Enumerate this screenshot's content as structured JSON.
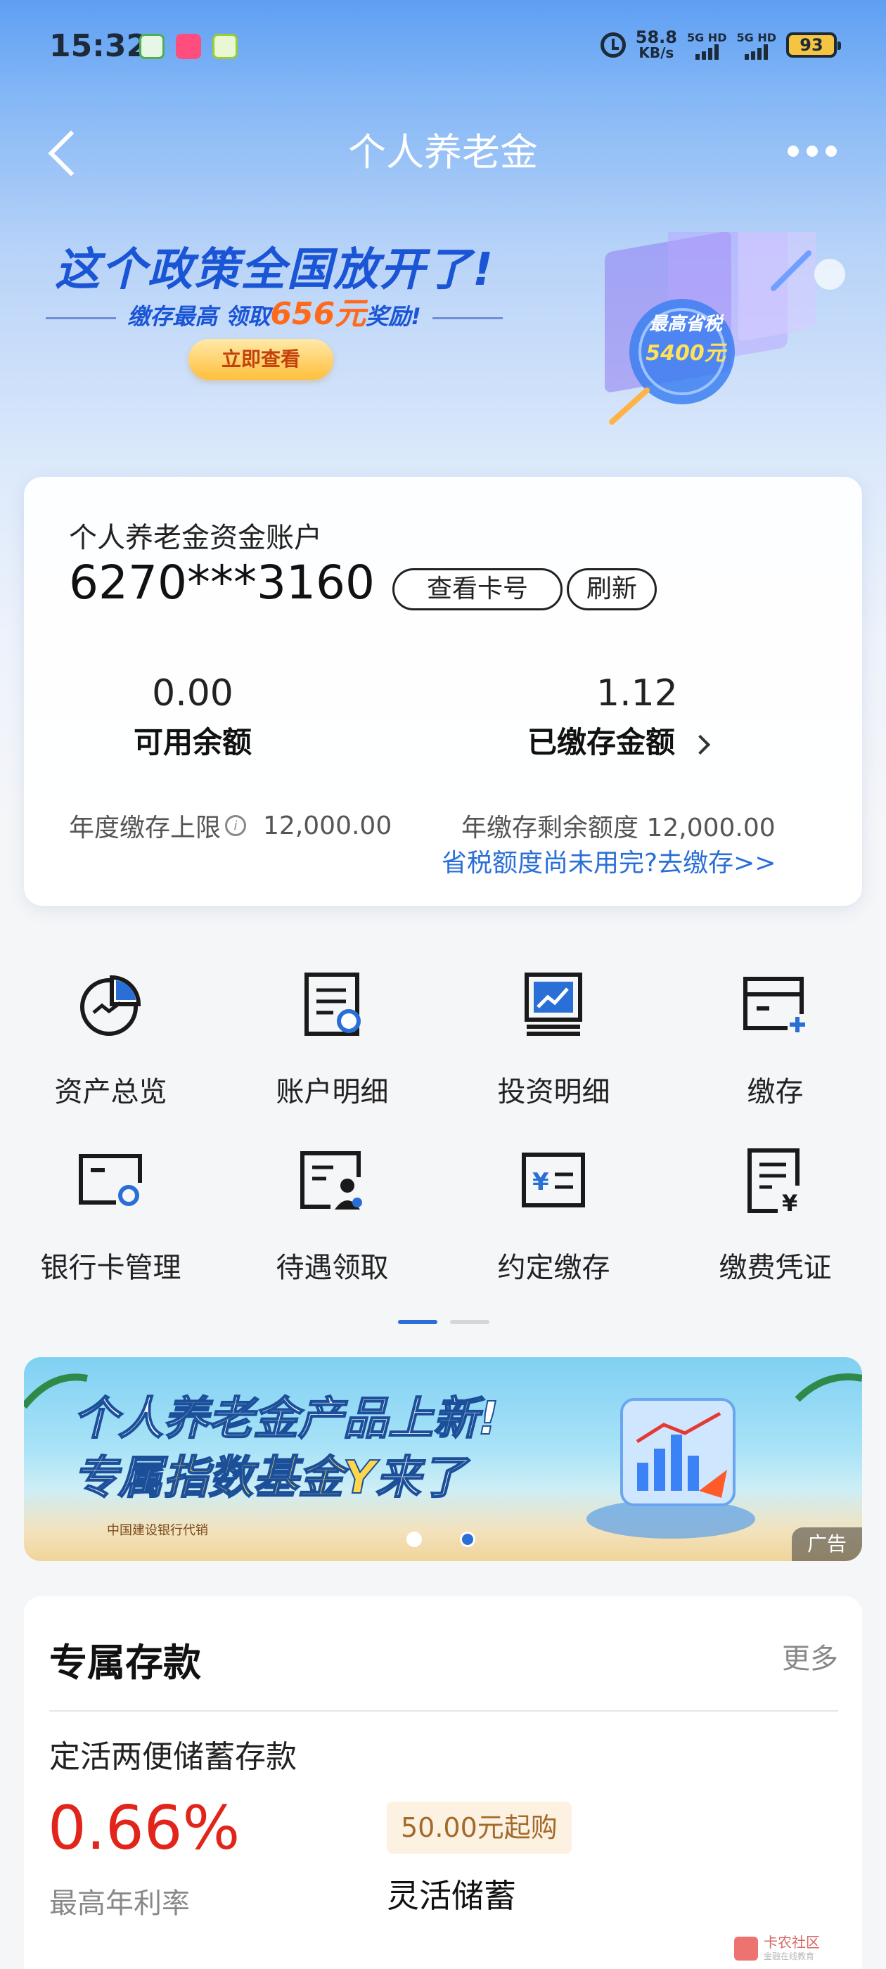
{
  "status_bar": {
    "time": "15:32",
    "speed_value": "58.8",
    "speed_unit": "KB/s",
    "sim1": "5G HD",
    "sim2": "5G HD",
    "battery": "93"
  },
  "header": {
    "title": "个人养老金"
  },
  "banner": {
    "title": "这个政策全国放开了!",
    "sub_prefix": "缴存最高 领取",
    "sub_amount": "656元",
    "sub_suffix": "奖励!",
    "button": "立即查看",
    "badge_line1": "最高省税",
    "badge_line2": "5400元"
  },
  "account": {
    "label": "个人养老金资金账户",
    "number": "6270***3160",
    "view_card_button": "查看卡号",
    "refresh_button": "刷新",
    "available_value": "0.00",
    "available_label": "可用余额",
    "deposited_value": "1.12",
    "deposited_label": "已缴存金额",
    "annual_limit_label": "年度缴存上限",
    "annual_limit_value": "12,000.00",
    "remaining_label": "年缴存剩余额度",
    "remaining_value": "12,000.00",
    "tax_link": "省税额度尚未用完?去缴存>>"
  },
  "functions": [
    {
      "label": "资产总览",
      "icon": "asset-overview-icon"
    },
    {
      "label": "账户明细",
      "icon": "account-detail-icon"
    },
    {
      "label": "投资明细",
      "icon": "investment-detail-icon"
    },
    {
      "label": "缴存",
      "icon": "deposit-icon"
    },
    {
      "label": "银行卡管理",
      "icon": "bank-card-icon"
    },
    {
      "label": "待遇领取",
      "icon": "benefit-claim-icon"
    },
    {
      "label": "约定缴存",
      "icon": "scheduled-deposit-icon"
    },
    {
      "label": "缴费凭证",
      "icon": "payment-voucher-icon"
    }
  ],
  "function_pages": {
    "count": 2,
    "active": 1
  },
  "promo": {
    "line1": "个人养老金产品上新!",
    "line2_prefix": "专属",
    "line2_highlight": "指数基金Y",
    "line2_suffix": "来了",
    "agent": "中国建设银行代销",
    "ad_label": "广告",
    "active_slide": 2
  },
  "deposit": {
    "section_title": "专属存款",
    "more_label": "更多",
    "product_name": "定活两便储蓄存款",
    "rate": "0.66%",
    "rate_label": "最高年利率",
    "min_purchase": "50.00元起购",
    "product_type": "灵活储蓄"
  },
  "watermark": {
    "text": "卡农社区",
    "sub": "金融在线教育"
  },
  "colors": {
    "primary_blue": "#2a6fd6",
    "rate_red": "#e1251b",
    "icon_blue": "#2a6fd6"
  }
}
